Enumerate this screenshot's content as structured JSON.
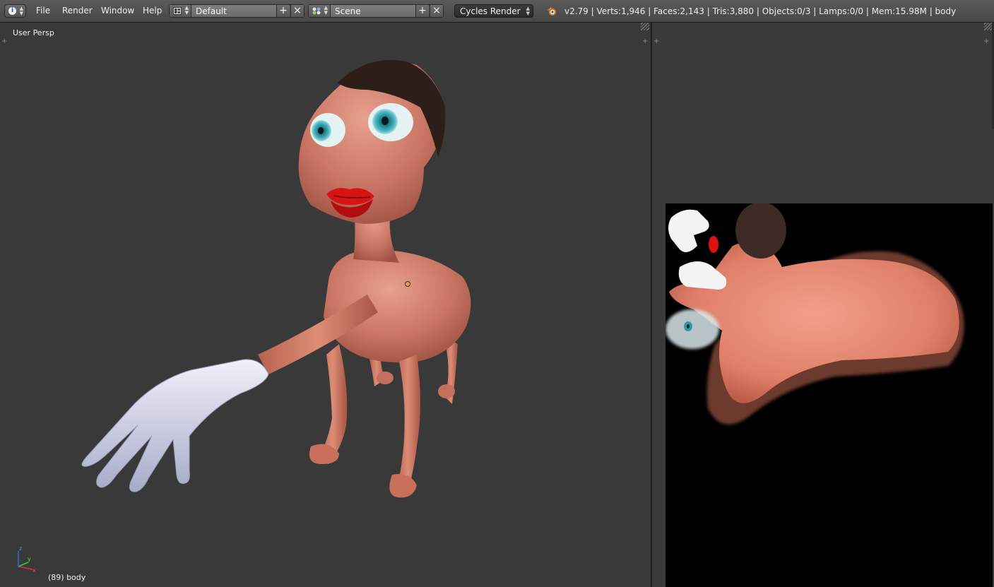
{
  "header": {
    "menus": [
      "File",
      "Render",
      "Window",
      "Help"
    ],
    "screen_layout": "Default",
    "scene": "Scene",
    "render_engine": "Cycles Render",
    "stats": "v2.79 | Verts:1,946 | Faces:2,143 | Tris:3,880 | Objects:0/3 | Lamps:0/0 | Mem:15.98M | body",
    "add_symbol": "+",
    "close_symbol": "×"
  },
  "viewport": {
    "view_name": "User Persp",
    "object_info": "(89) body",
    "axis_labels": {
      "x": "x",
      "y": "y",
      "z": "z"
    }
  },
  "icons": {
    "info": "info-icon",
    "layout": "screen-layout-icon",
    "scene": "scene-icon",
    "blender": "blender-logo-icon"
  },
  "colors": {
    "header_bg": "#4f4f4f",
    "viewport_bg": "#393939",
    "skin": "#d87f6c",
    "glove": "#d8dbef",
    "lips": "#d01010",
    "eye_iris": "#3aa7b0",
    "texture_bg": "#000000"
  }
}
